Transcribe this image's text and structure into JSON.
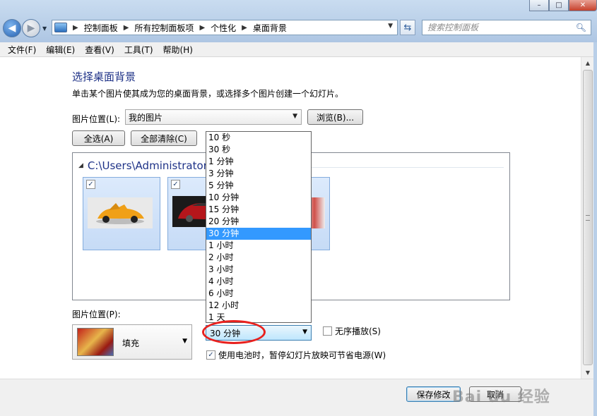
{
  "window": {
    "minimize_symbol": "–",
    "maximize_symbol": "□",
    "close_symbol": "✕"
  },
  "address": {
    "crumbs": [
      "控制面板",
      "所有控制面板项",
      "个性化",
      "桌面背景"
    ],
    "search_placeholder": "搜索控制面板"
  },
  "menu": [
    "文件(F)",
    "编辑(E)",
    "查看(V)",
    "工具(T)",
    "帮助(H)"
  ],
  "page": {
    "title": "选择桌面背景",
    "description": "单击某个图片使其成为您的桌面背景，或选择多个图片创建一个幻灯片。"
  },
  "location": {
    "label": "图片位置(L):",
    "value": "我的图片",
    "browse": "浏览(B)..."
  },
  "buttons": {
    "select_all": "全选(A)",
    "clear_all": "全部清除(C)",
    "save": "保存修改",
    "cancel": "取消"
  },
  "gallery": {
    "group_path": "C:\\Users\\Administrator",
    "items": [
      {
        "checked": true,
        "check_mark": "✓"
      },
      {
        "checked": true,
        "check_mark": "✓"
      }
    ]
  },
  "interval": {
    "options": [
      "10 秒",
      "30 秒",
      "1 分钟",
      "3 分钟",
      "5 分钟",
      "10 分钟",
      "15 分钟",
      "20 分钟",
      "30 分钟",
      "1 小时",
      "2 小时",
      "3 小时",
      "4 小时",
      "6 小时",
      "12 小时",
      "1 天"
    ],
    "selected": "30 分钟"
  },
  "position": {
    "label": "图片位置(P):",
    "value": "填充"
  },
  "shuffle": {
    "label": "无序播放(S)",
    "checked": false
  },
  "battery": {
    "label": "使用电池时，暂停幻灯片放映可节省电源(W)",
    "checked": true,
    "check_mark": "✓"
  },
  "watermark": "Bai du 经验",
  "colors": {
    "title": "#1e3287",
    "selection": "#3399ff",
    "annotation": "#e8211e"
  }
}
